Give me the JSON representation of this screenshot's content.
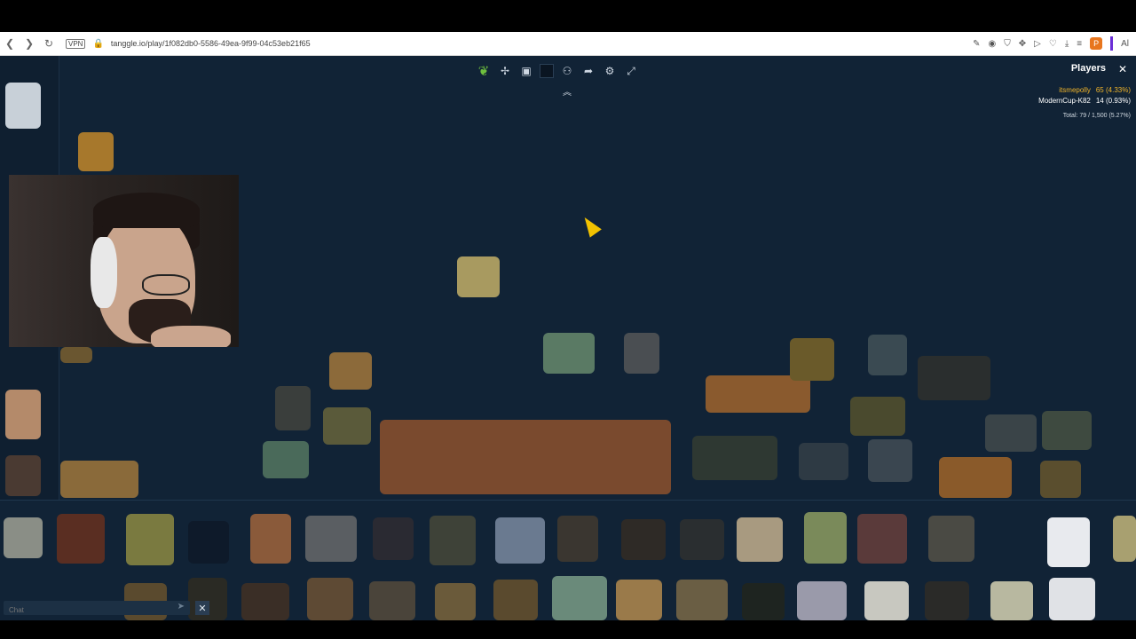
{
  "browser": {
    "url": "tanggle.io/play/1f082db0-5586-49ea-9f99-04c53eb21f65",
    "vpn_label": "VPN",
    "profile_initial": "P",
    "ai_label": "Al"
  },
  "toolbar": {
    "icons": [
      "logo-leaf-icon",
      "puzzle-icon",
      "image-preview-icon",
      "background-icon",
      "players-icon",
      "share-icon",
      "settings-icon",
      "fullscreen-icon"
    ]
  },
  "players_panel": {
    "title": "Players",
    "players": [
      {
        "name": "itsmepolly",
        "score": "65 (4.33%)"
      },
      {
        "name": "ModernCup-K82",
        "score": "14 (0.93%)"
      }
    ],
    "total": "Total: 79 / 1,500 (5.27%)"
  },
  "chat": {
    "placeholder": "Chat"
  },
  "colors": {
    "board_bg": "#112336",
    "player1_color": "#f0b429",
    "accent_green": "#6fbf3e"
  }
}
